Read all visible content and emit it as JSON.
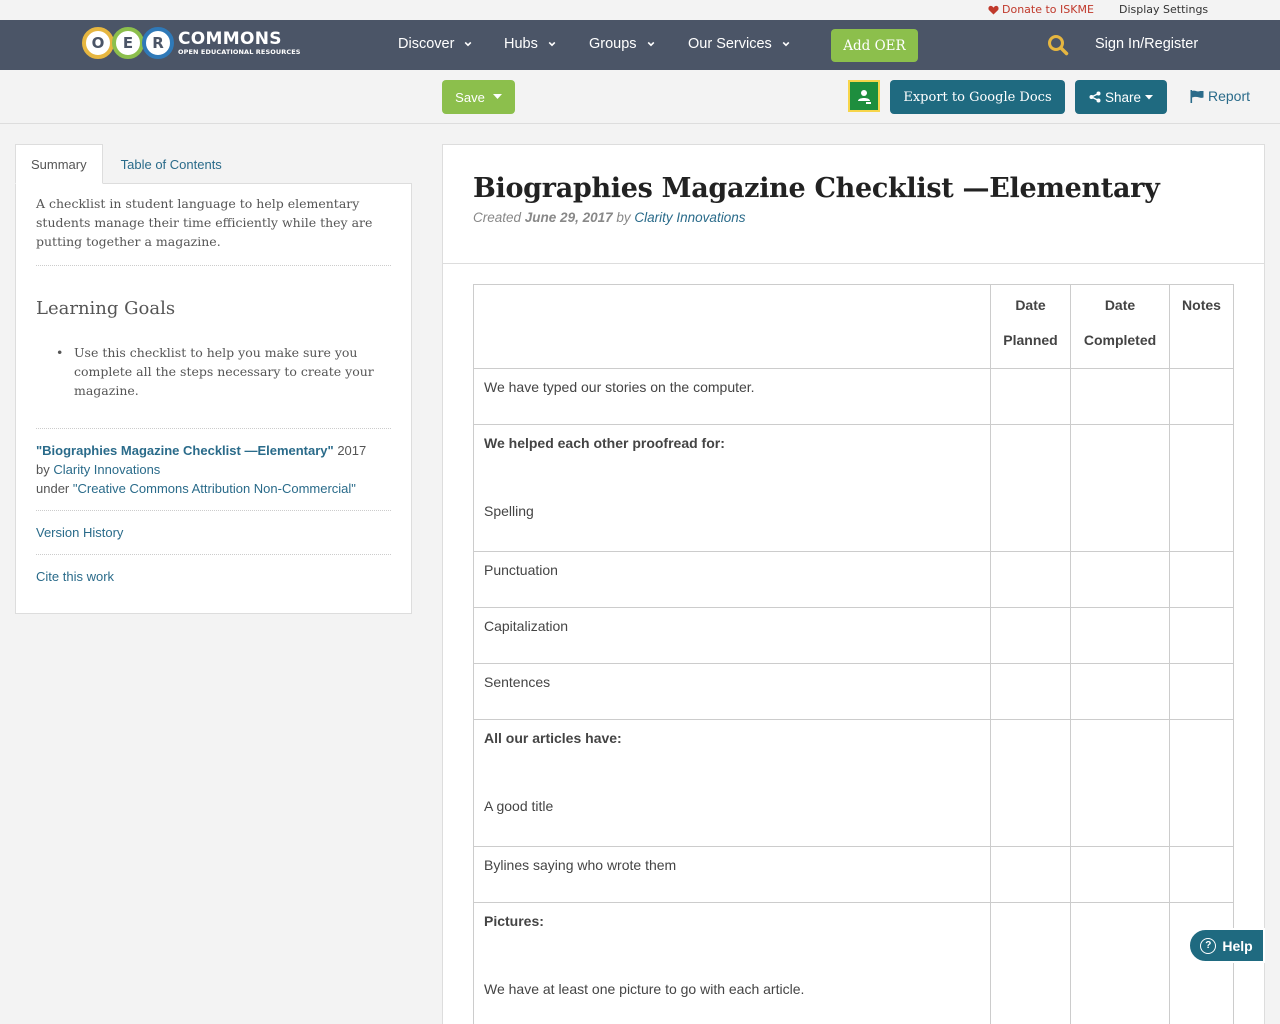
{
  "utility": {
    "donate": "Donate to ISKME",
    "display_settings": "Display Settings"
  },
  "logo": {
    "letters": [
      "O",
      "E",
      "R"
    ],
    "name": "COMMONS",
    "tagline": "OPEN EDUCATIONAL RESOURCES"
  },
  "nav": {
    "items": [
      "Discover",
      "Hubs",
      "Groups",
      "Our Services"
    ],
    "add_oer": "Add OER",
    "signin": "Sign In/Register"
  },
  "toolbar": {
    "save": "Save",
    "export": "Export to Google Docs",
    "share": "Share",
    "report": "Report"
  },
  "sidebar": {
    "tabs": [
      "Summary",
      "Table of Contents"
    ],
    "description": "A checklist in student language to help elementary students manage their time efficiently while they are putting together a magazine.",
    "learning_goals_title": "Learning Goals",
    "learning_goals": [
      "Use this checklist to help you make sure you complete all the steps necessary to create your magazine."
    ],
    "attribution": {
      "title": "\"Biographies Magazine Checklist —Elementary\"",
      "year": "2017",
      "by": "by",
      "author": "Clarity Innovations",
      "under": "under",
      "license": "\"Creative Commons Attribution Non-Commercial\""
    },
    "version_history": "Version History",
    "cite": "Cite this work"
  },
  "resource": {
    "title": "Biographies Magazine Checklist —Elementary",
    "created_label": "Created",
    "created_date": "June 29, 2017",
    "by_label": "by",
    "author": "Clarity Innovations"
  },
  "checklist": {
    "headers": [
      "",
      "Date\nPlanned",
      "Date\nCompleted",
      "Notes"
    ],
    "rows": [
      {
        "text": "We have typed our stories on the computer.",
        "bold": false,
        "sub": ""
      },
      {
        "text": "We helped each other proofread for:",
        "bold": true,
        "sub": "Spelling"
      },
      {
        "text": "Punctuation",
        "bold": false,
        "sub": ""
      },
      {
        "text": "Capitalization",
        "bold": false,
        "sub": ""
      },
      {
        "text": "Sentences",
        "bold": false,
        "sub": ""
      },
      {
        "text": "All our articles have:",
        "bold": true,
        "sub": "A good title"
      },
      {
        "text": "Bylines saying who wrote them",
        "bold": false,
        "sub": ""
      },
      {
        "text": "Pictures:",
        "bold": true,
        "sub": "We have at least one picture to go with each article."
      }
    ]
  },
  "help": "Help"
}
